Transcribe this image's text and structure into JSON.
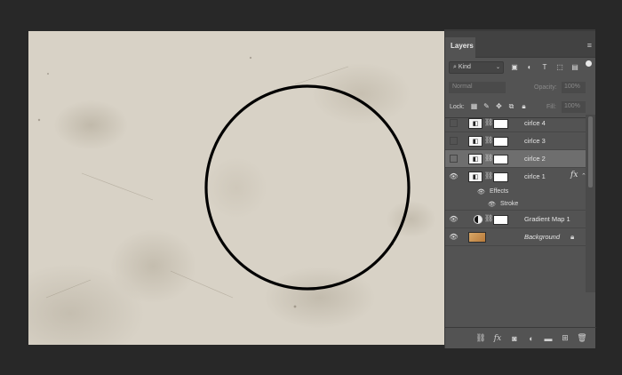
{
  "window_controls": {
    "collapse": "«",
    "close": "✕"
  },
  "panel": {
    "tab_label": "Layers",
    "menu_icon": "hamburger-menu-icon",
    "filter": {
      "kind_label": "Kind",
      "search_icon": "search-icon"
    },
    "blend_mode": "Normal",
    "opacity_label": "Opacity:",
    "opacity_value": "100%",
    "lock_label": "Lock:",
    "fill_label": "Fill:",
    "fill_value": "100%"
  },
  "layers": [
    {
      "name": "cirlce 4",
      "visible": false
    },
    {
      "name": "cirlce 3",
      "visible": false
    },
    {
      "name": "cirlce 2",
      "visible": false,
      "selected": true
    },
    {
      "name": "cirlce 1",
      "visible": true,
      "has_fx": true,
      "fx_label": "fx"
    },
    {
      "effects_label": "Effects",
      "effect_name": "Stroke"
    },
    {
      "name": "Gradient Map 1",
      "visible": true
    },
    {
      "name": "Background",
      "visible": true,
      "locked": true
    }
  ],
  "canvas": {
    "background_color": "#d8d2c6",
    "circle_stroke_color": "#000000"
  }
}
